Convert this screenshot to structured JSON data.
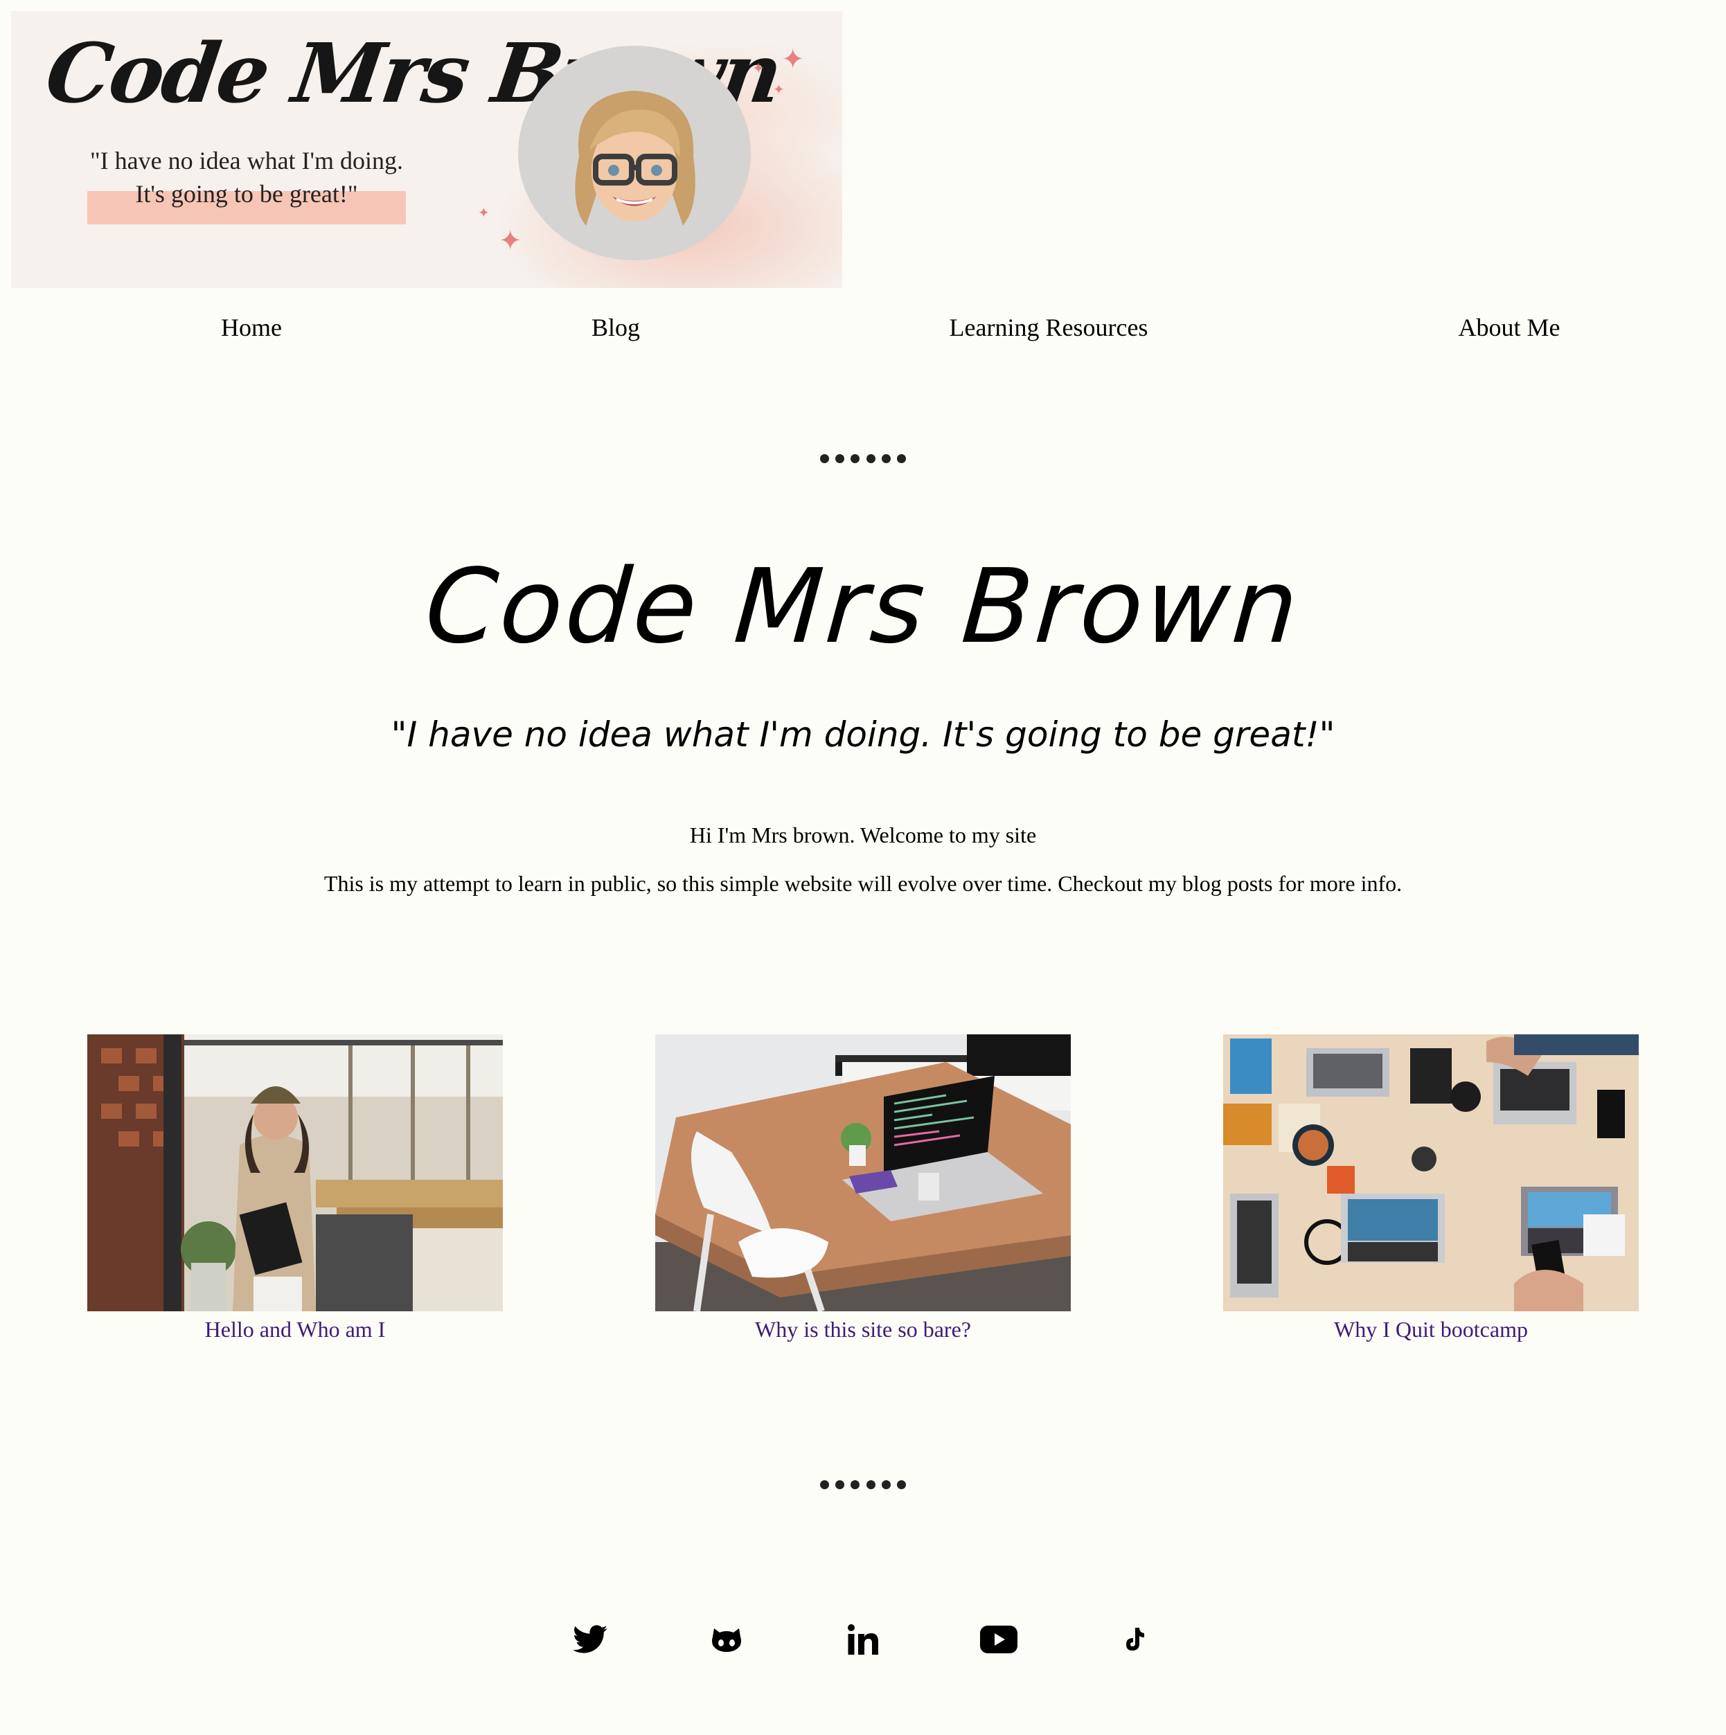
{
  "banner": {
    "title": "Code Mrs Brown",
    "quote": "\"I have no idea what I'm doing. It's going to be great!\""
  },
  "nav": {
    "items": [
      {
        "label": "Home"
      },
      {
        "label": "Blog"
      },
      {
        "label": "Learning Resources"
      },
      {
        "label": "About Me"
      }
    ]
  },
  "hero": {
    "title": "Code Mrs Brown",
    "quote": "\"I have no idea what I'm doing. It's going to be great!\"",
    "intro_line1": "Hi I'm Mrs brown. Welcome to my site",
    "intro_line2": "This is my attempt to learn in public, so this simple website will evolve over time. Checkout my blog posts for more info."
  },
  "posts": [
    {
      "title": "Hello and Who am I",
      "image_icon": "woman-with-laptop-photo"
    },
    {
      "title": "Why is this site so bare?",
      "image_icon": "laptop-on-desk-photo"
    },
    {
      "title": "Why I Quit bootcamp",
      "image_icon": "team-laptops-table-photo"
    }
  ],
  "social": [
    {
      "icon": "twitter-icon"
    },
    {
      "icon": "github-icon"
    },
    {
      "icon": "linkedin-icon"
    },
    {
      "icon": "youtube-icon"
    },
    {
      "icon": "tiktok-icon"
    }
  ],
  "colors": {
    "background": "#fdfdf7",
    "link": "#3f1a7a",
    "accent_pink": "#f7c5b6",
    "sparkle": "#e78081"
  }
}
